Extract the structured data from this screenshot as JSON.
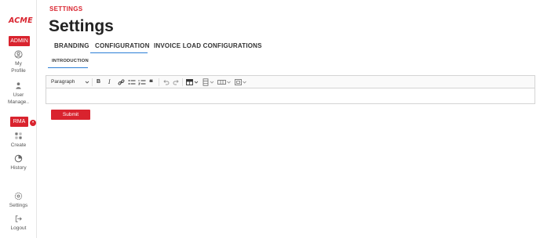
{
  "sidebar": {
    "logo": "ACME",
    "admin_badge": "ADMIN",
    "rma_badge": "RMA",
    "rma_dot": "•",
    "items": [
      {
        "label_line1": "My",
        "label_line2": "Profile",
        "icon": "user-circle-icon"
      },
      {
        "label_line1": "User",
        "label_line2": "Manage..",
        "icon": "users-icon"
      },
      {
        "label": "Create",
        "icon": "grid-icon"
      },
      {
        "label": "History",
        "icon": "history-icon"
      },
      {
        "label": "Settings",
        "icon": "gear-icon"
      },
      {
        "label": "Logout",
        "icon": "logout-icon"
      }
    ]
  },
  "header": {
    "breadcrumb": "SETTINGS",
    "title": "Settings"
  },
  "tabs": [
    {
      "label": "BRANDING"
    },
    {
      "label": "CONFIGURATION",
      "active": true
    },
    {
      "label": "INVOICE LOAD CONFIGURATIONS"
    }
  ],
  "subtabs": [
    {
      "label": "INTRODUCTION",
      "active": true
    }
  ],
  "editor": {
    "paragraph_select": "Paragraph",
    "body": ""
  },
  "actions": {
    "submit_label": "Submit"
  },
  "colors": {
    "brand_red": "#d9232e",
    "tab_accent": "#2c7fd6"
  }
}
